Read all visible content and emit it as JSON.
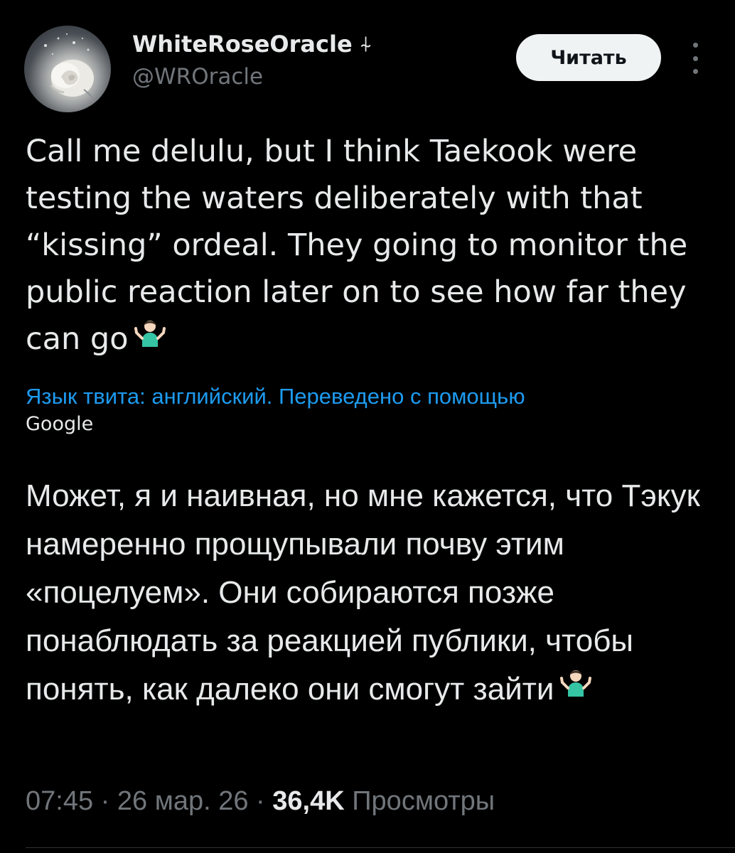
{
  "author": {
    "display_name": "WhiteRoseOracle",
    "name_symbol": "⍭",
    "handle": "@WROracle",
    "avatar_icon": "white-rose-avatar"
  },
  "actions": {
    "follow_label": "Читать",
    "more_icon": "more-vertical-icon"
  },
  "tweet": {
    "text": "Call me delulu, but I think Taekook were testing the waters deliberately with that “kissing” ordeal. They going to monitor the public reaction later on to see how far they can go",
    "emoji": "person-shrugging-emoji"
  },
  "translation": {
    "note": "Язык твита: английский. Переведено с помощью",
    "provider": "Google",
    "text": "Может, я и наивная, но мне кажется, что Тэкук намеренно прощупывали почву этим «поцелуем». Они собираются позже понаблюдать за реакцией публики, чтобы понять, как далеко они смогут зайти"
  },
  "meta": {
    "time": "07:45",
    "separator": " · ",
    "date": "26 мар. 26",
    "views_count": "36,4K",
    "views_label": "Просмотры"
  },
  "colors": {
    "background": "#000000",
    "text": "#e7e9ea",
    "secondary": "#71767b",
    "link": "#1d9bf0",
    "button_bg": "#eff3f4"
  }
}
